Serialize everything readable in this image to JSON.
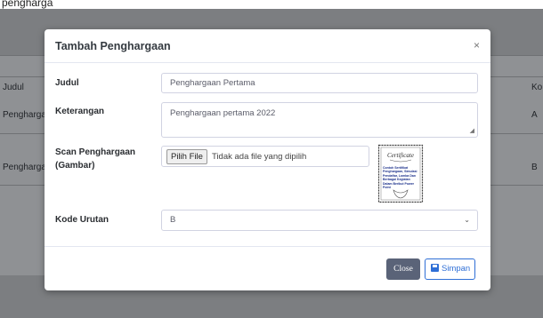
{
  "top_caption": "pengharga",
  "background": {
    "headers": {
      "judul": "Judul",
      "kode": "Ko"
    },
    "rows": [
      {
        "judul": "Pengharga",
        "kode": "A"
      },
      {
        "judul": "Pengharga",
        "kode": "B"
      }
    ]
  },
  "modal": {
    "title": "Tambah Penghargaan",
    "close_symbol": "×",
    "fields": {
      "judul": {
        "label": "Judul",
        "value": "Penghargaan Pertama"
      },
      "keterangan": {
        "label": "Keterangan",
        "value": "Penghargaan pertama 2022"
      },
      "scan": {
        "label_line1": "Scan Penghargaan",
        "label_line2": "(Gambar)",
        "button_label": "Pilih File",
        "no_file_text": "Tidak ada file yang dipilih",
        "thumbnail": {
          "heading": "Certificate",
          "text": "Contoh Sertifikat Penghargaan, Simulasi Pendaftar, Lomba Dan Berbagai Kegiatan Dalam Berikut Power Point"
        }
      },
      "kode_urutan": {
        "label": "Kode Urutan",
        "value": "B"
      }
    },
    "footer": {
      "close_label": "Close",
      "save_label": "Simpan"
    }
  }
}
